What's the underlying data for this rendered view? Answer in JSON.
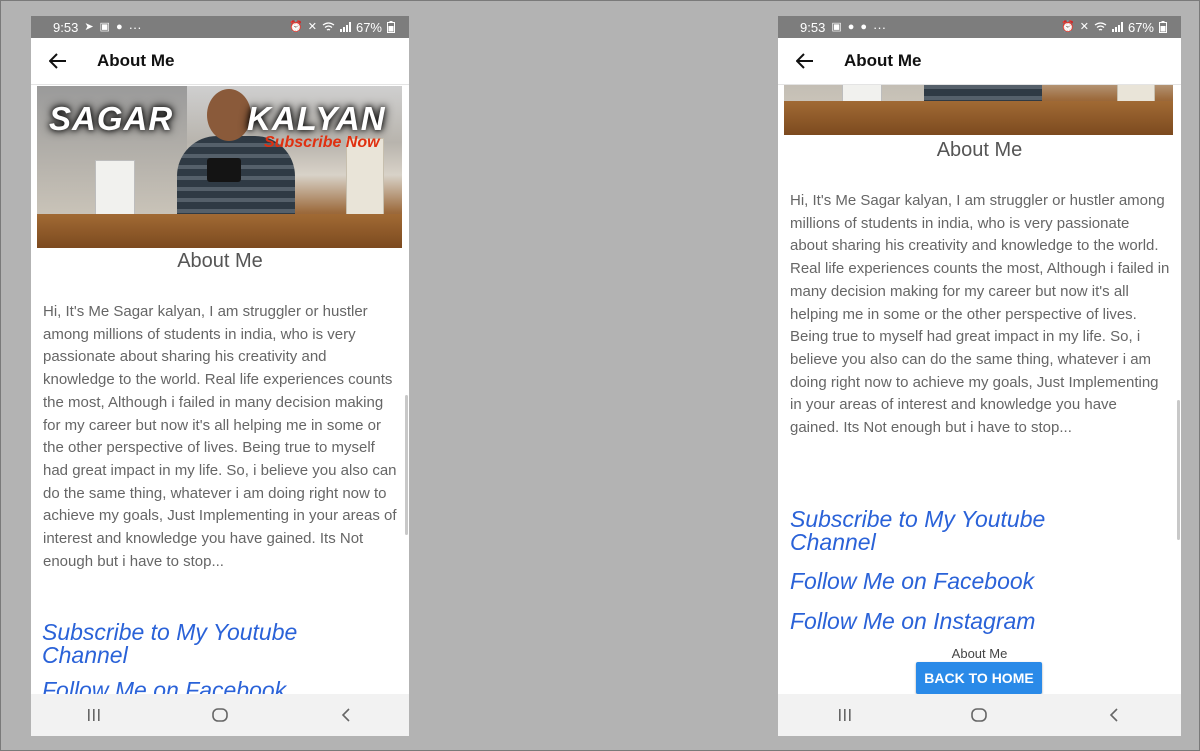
{
  "status_bar": {
    "time": "9:53",
    "more_icon": "···",
    "battery_text": "67%"
  },
  "app_bar": {
    "title": "About Me"
  },
  "banner": {
    "name_first": "SAGAR",
    "name_last": "KALYAN",
    "tagline": "Subscribe Now"
  },
  "about": {
    "heading": "About Me",
    "paragraph": "Hi, It's Me Sagar kalyan, I am struggler or hustler among millions of students in india, who is very passionate about sharing his creativity and knowledge to the world. Real life experiences counts the most, Although i failed in many decision making for my career but now it's all helping me in some or the other perspective of lives. Being true to myself had great impact in my life. So, i believe you also can do the same thing, whatever i am doing right now to achieve my goals, Just Implementing in your areas of interest and knowledge you have gained. Its Not enough but i have to stop..."
  },
  "links": {
    "youtube": "Subscribe to My Youtube Channel",
    "facebook": "Follow Me on Facebook",
    "instagram": "Follow Me on Instagram"
  },
  "footer": {
    "label": "About Me",
    "back_home": "BACK TO HOME"
  },
  "colors": {
    "link": "#2a62d8",
    "button": "#2a8ae8",
    "status_bar": "#7d7d7d"
  },
  "icons": [
    "back-arrow-icon",
    "recents-icon",
    "home-icon",
    "back-nav-icon",
    "wifi-icon",
    "signal-icon",
    "battery-icon",
    "alarm-icon",
    "mute-icon"
  ]
}
